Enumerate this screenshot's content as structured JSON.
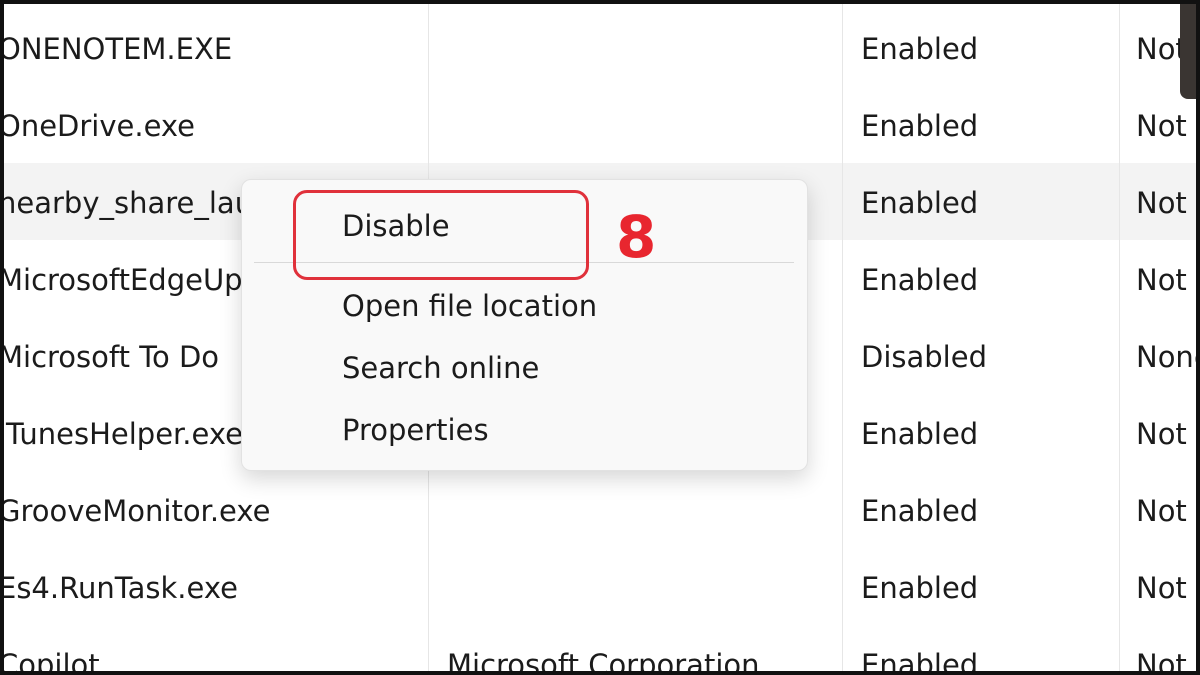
{
  "rows": [
    {
      "name": "ONENOTEM.EXE",
      "publisher": "",
      "status": "Enabled",
      "impact": "Not"
    },
    {
      "name": "OneDrive.exe",
      "publisher": "",
      "status": "Enabled",
      "impact": "Not"
    },
    {
      "name": "nearby_share_lau",
      "publisher": "",
      "status": "Enabled",
      "impact": "Not"
    },
    {
      "name": "MicrosoftEdgeUp",
      "publisher": "",
      "status": "Enabled",
      "impact": "Not"
    },
    {
      "name": "Microsoft To Do",
      "publisher": "",
      "status": "Disabled",
      "impact": "None"
    },
    {
      "name": "iTunesHelper.exe",
      "publisher": "",
      "status": "Enabled",
      "impact": "Not"
    },
    {
      "name": "GrooveMonitor.exe",
      "publisher": "",
      "status": "Enabled",
      "impact": "Not"
    },
    {
      "name": "Es4.RunTask.exe",
      "publisher": "",
      "status": "Enabled",
      "impact": "Not"
    },
    {
      "name": "Copilot",
      "publisher": "Microsoft Corporation",
      "status": "Enabled",
      "impact": "Not"
    }
  ],
  "highlighted_row_index": 2,
  "context_menu": {
    "items": [
      "Disable",
      "Open file location",
      "Search online",
      "Properties"
    ]
  },
  "annotation": {
    "step_number": "8",
    "color": "#e8262f"
  }
}
